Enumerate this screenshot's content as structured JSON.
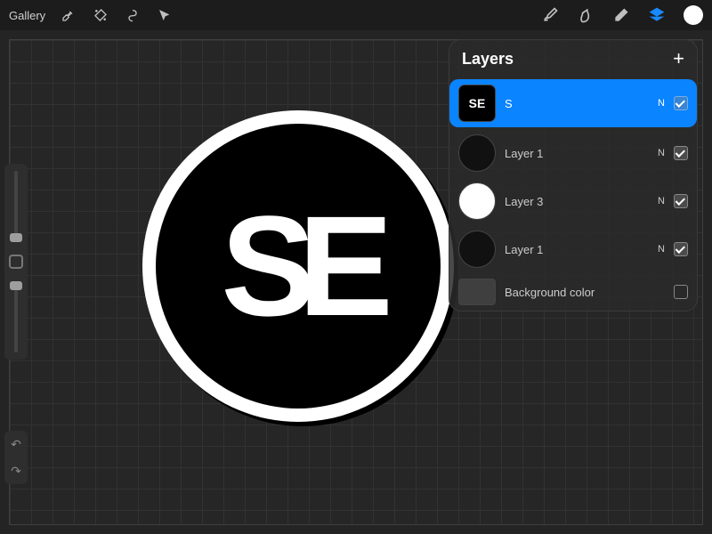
{
  "top_bar": {
    "gallery_label": "Gallery"
  },
  "layers_panel": {
    "title": "Layers",
    "items": [
      {
        "name": "S",
        "blend": "N",
        "visible": true,
        "selected": true,
        "thumb": "se-mono"
      },
      {
        "name": "Layer 1",
        "blend": "N",
        "visible": true,
        "selected": false,
        "thumb": "black-circle"
      },
      {
        "name": "Layer 3",
        "blend": "N",
        "visible": true,
        "selected": false,
        "thumb": "white-circle"
      },
      {
        "name": "Layer 1",
        "blend": "N",
        "visible": true,
        "selected": false,
        "thumb": "black-circle"
      },
      {
        "name": "Background color",
        "blend": "",
        "visible": false,
        "selected": false,
        "thumb": "bg-swatch"
      }
    ]
  },
  "artwork": {
    "monogram": "SE"
  }
}
